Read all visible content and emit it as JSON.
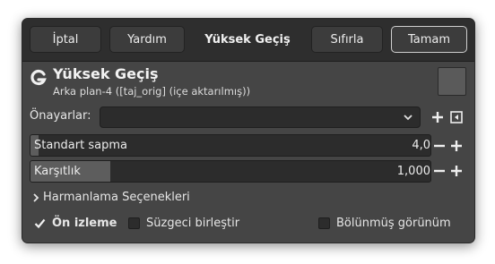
{
  "header": {
    "cancel_label": "İptal",
    "help_label": "Yardım",
    "title": "Yüksek Geçiş",
    "reset_label": "Sıfırla",
    "ok_label": "Tamam"
  },
  "filter": {
    "title": "Yüksek Geçiş",
    "subtitle": "Arka plan-4 ([taj_orig] (içe aktarılmış))",
    "logo_icon": "gegl-g-icon"
  },
  "presets": {
    "label": "Önayarlar:",
    "selected": "",
    "add_icon": "plus-icon",
    "menu_icon": "preset-menu-icon"
  },
  "params": [
    {
      "label": "Standart sapma",
      "value": "4,0",
      "fill_fraction": 0.02
    },
    {
      "label": "Karşıtlık",
      "value": "1,000",
      "fill_fraction": 0.2
    }
  ],
  "blending": {
    "label": "Harmanlama Seçenekleri"
  },
  "options": {
    "preview": {
      "label": "Ön izleme",
      "checked": true
    },
    "merge": {
      "label": "Süzgeci birleştir",
      "checked": false
    },
    "split": {
      "label": "Bölünmüş görünüm",
      "checked": false
    }
  },
  "colors": {
    "dialog_bg": "#454545",
    "header_bg": "#2e2e2e",
    "field_bg": "#2c2c2c",
    "fill": "#5d5d5d"
  }
}
